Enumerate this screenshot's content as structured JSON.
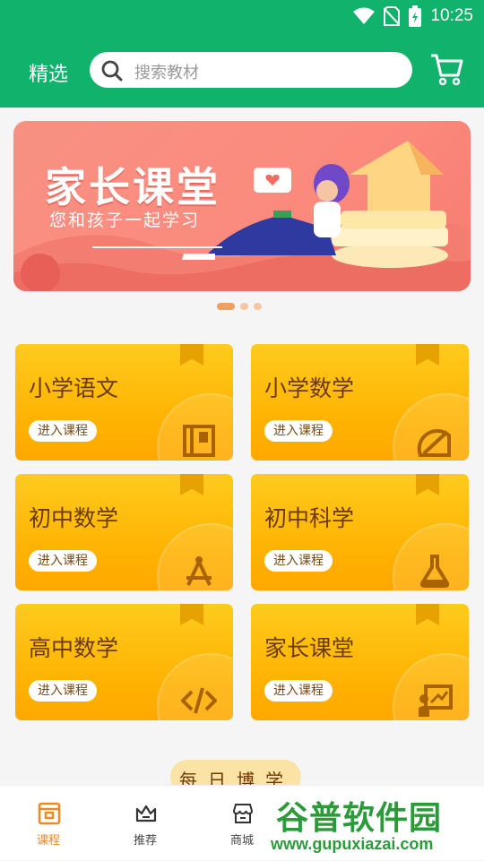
{
  "status": {
    "time": "10:25"
  },
  "header": {
    "title": "精选",
    "search_placeholder": "搜索教材"
  },
  "banner": {
    "title": "家长课堂",
    "subtitle": "您和孩子一起学习"
  },
  "courses": [
    {
      "title": "小学语文",
      "button": "进入课程",
      "icon": "book-icon"
    },
    {
      "title": "小学数学",
      "button": "进入课程",
      "icon": "protractor-icon"
    },
    {
      "title": "初中数学",
      "button": "进入课程",
      "icon": "compass-icon"
    },
    {
      "title": "初中科学",
      "button": "进入课程",
      "icon": "flask-icon"
    },
    {
      "title": "高中数学",
      "button": "进入课程",
      "icon": "code-icon"
    },
    {
      "title": "家长课堂",
      "button": "进入课程",
      "icon": "classroom-icon"
    }
  ],
  "daily": {
    "title": "每日博学"
  },
  "nav": [
    {
      "label": "课程",
      "active": true
    },
    {
      "label": "推荐",
      "active": false
    },
    {
      "label": "商城",
      "active": false
    },
    {
      "label": "",
      "active": false
    },
    {
      "label": "",
      "active": false
    }
  ],
  "watermark": {
    "text": "谷普软件园",
    "url": "www.gupuxiazai.com"
  },
  "colors": {
    "primary": "#11b26c",
    "card": "#ffb100",
    "accent": "#f08a1e"
  }
}
